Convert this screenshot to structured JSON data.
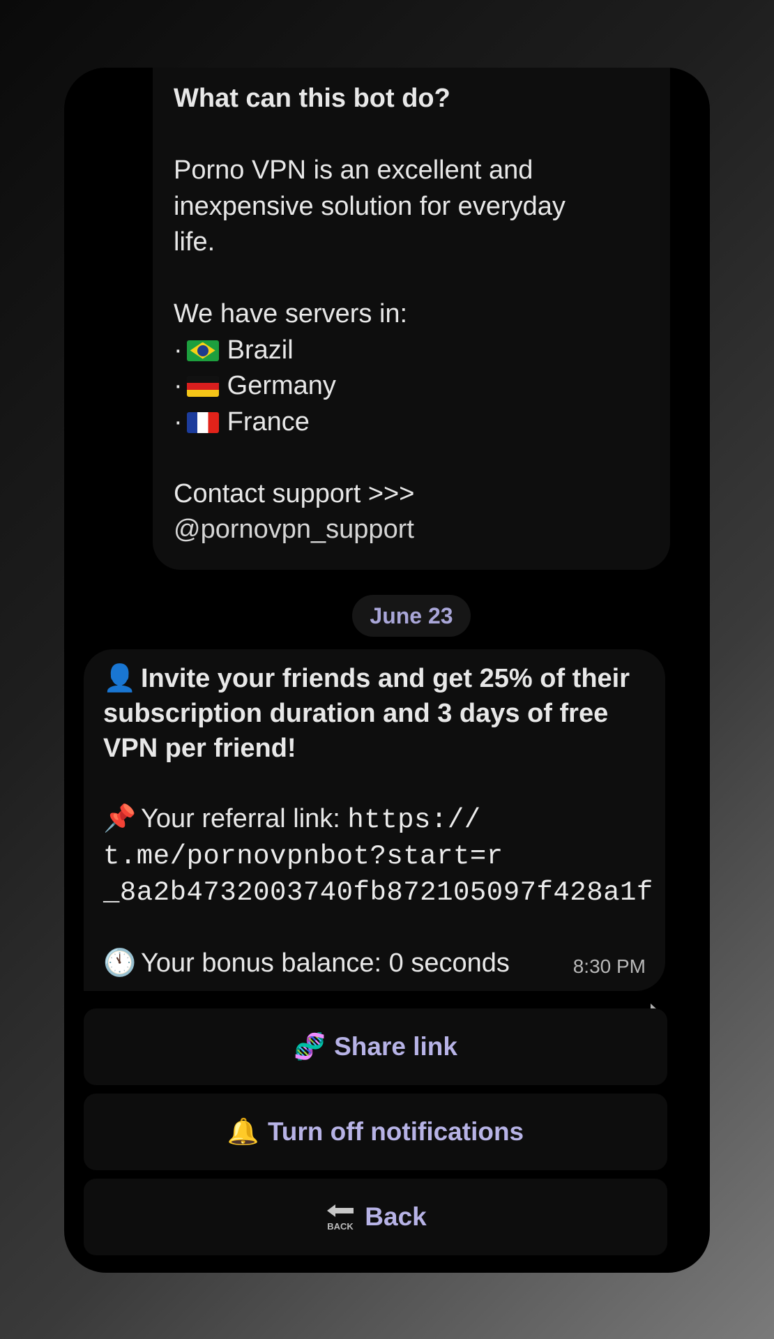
{
  "intro": {
    "title": "What can this bot do?",
    "desc_line1": "Porno VPN is an excellent and",
    "desc_line2": "inexpensive solution for everyday",
    "desc_line3": "life.",
    "servers_heading": "We have servers in:",
    "servers": [
      {
        "bullet": "·",
        "flag": "brazil-flag-icon",
        "name": "Brazil"
      },
      {
        "bullet": "·",
        "flag": "germany-flag-icon",
        "name": "Germany"
      },
      {
        "bullet": "·",
        "flag": "france-flag-icon",
        "name": "France"
      }
    ],
    "support_label": "Contact support >>>",
    "support_handle": "@pornovpn_support"
  },
  "date_separator": "June 23",
  "message": {
    "invite_emoji": "👤",
    "invite_line1": "Invite your friends and get 25% of their",
    "invite_line2": "subscription duration and 3 days of free",
    "invite_line3": "VPN per friend!",
    "pin_emoji": "📌",
    "referral_label": "Your referral link:",
    "referral_url_part1": "https://",
    "referral_url_part2": "t.me/pornovpnbot?start=r",
    "referral_url_part3": "_8a2b4732003740fb872105097f428a1f",
    "clock_emoji": "🕚",
    "balance_text": "Your bonus balance: 0 seconds",
    "time": "8:30 PM"
  },
  "buttons": {
    "share": {
      "icon": "🧬",
      "label": "Share link"
    },
    "notifications": {
      "icon": "🔔",
      "label": "Turn off notifications"
    },
    "back": {
      "icon_text": "BACK",
      "label": "Back"
    }
  }
}
